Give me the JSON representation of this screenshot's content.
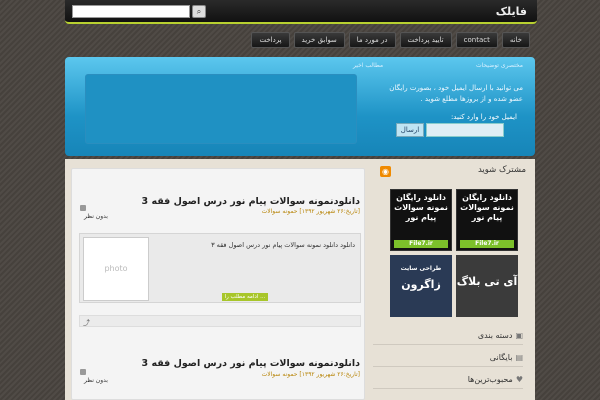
{
  "header": {
    "logo": "فایلک",
    "search_icon": "⌕"
  },
  "nav": {
    "items": [
      "خانه",
      "contact",
      "تایید پرداخت",
      "در مورد ما",
      "سوابق خرید",
      "پرداخت"
    ]
  },
  "banner": {
    "newsletter_title": "مختصری توضیحات",
    "news_title": "مطالب اخیر",
    "description": "می توانید با ارسال ایمیل خود ، بصورت رایگان عضو شده و از بروزها مطلع شوید .",
    "email_label": "ایمیل خود را وارد کنید:",
    "send_label": "ارسال"
  },
  "posts": [
    {
      "title": "دانلودنمونه سوالات پیام نور درس اصول فقه 3",
      "meta": "[تاریخ:۲۶ شهریور ۱۳۹۲] حمونه سوالات",
      "comments": "بدون نظر",
      "photo_label": "photo",
      "excerpt": "دانلود دانلود نمونه سوالات پیام نور درس اصول فقه ۳",
      "more_label": "ادامه مطلب را ..."
    },
    {
      "title": "دانلودنمونه سوالات پیام نور درس اصول فقه 3",
      "meta": "[تاریخ:۲۶ شهریور ۱۳۹۲] حمونه سوالات",
      "comments": "بدون نظر"
    }
  ],
  "sidebar": {
    "subscribe": "مشترک شوید",
    "ads": [
      {
        "text": "دانلود رایگان نمونه سوالات پیام نور",
        "tag": "File7.ir"
      },
      {
        "text": "دانلود رایگان نمونه سوالات پیام نور",
        "tag": "File7.ir"
      },
      {
        "text": "طراحی سایت",
        "brand": "زاگرون"
      },
      {
        "text": "آی تی بلاگ"
      }
    ],
    "items": [
      "دسته بندی",
      "بایگانی",
      "محبوب‌ترین‌ها"
    ]
  },
  "colors": {
    "accent": "#b8d030",
    "banner": "#1e93c6"
  }
}
